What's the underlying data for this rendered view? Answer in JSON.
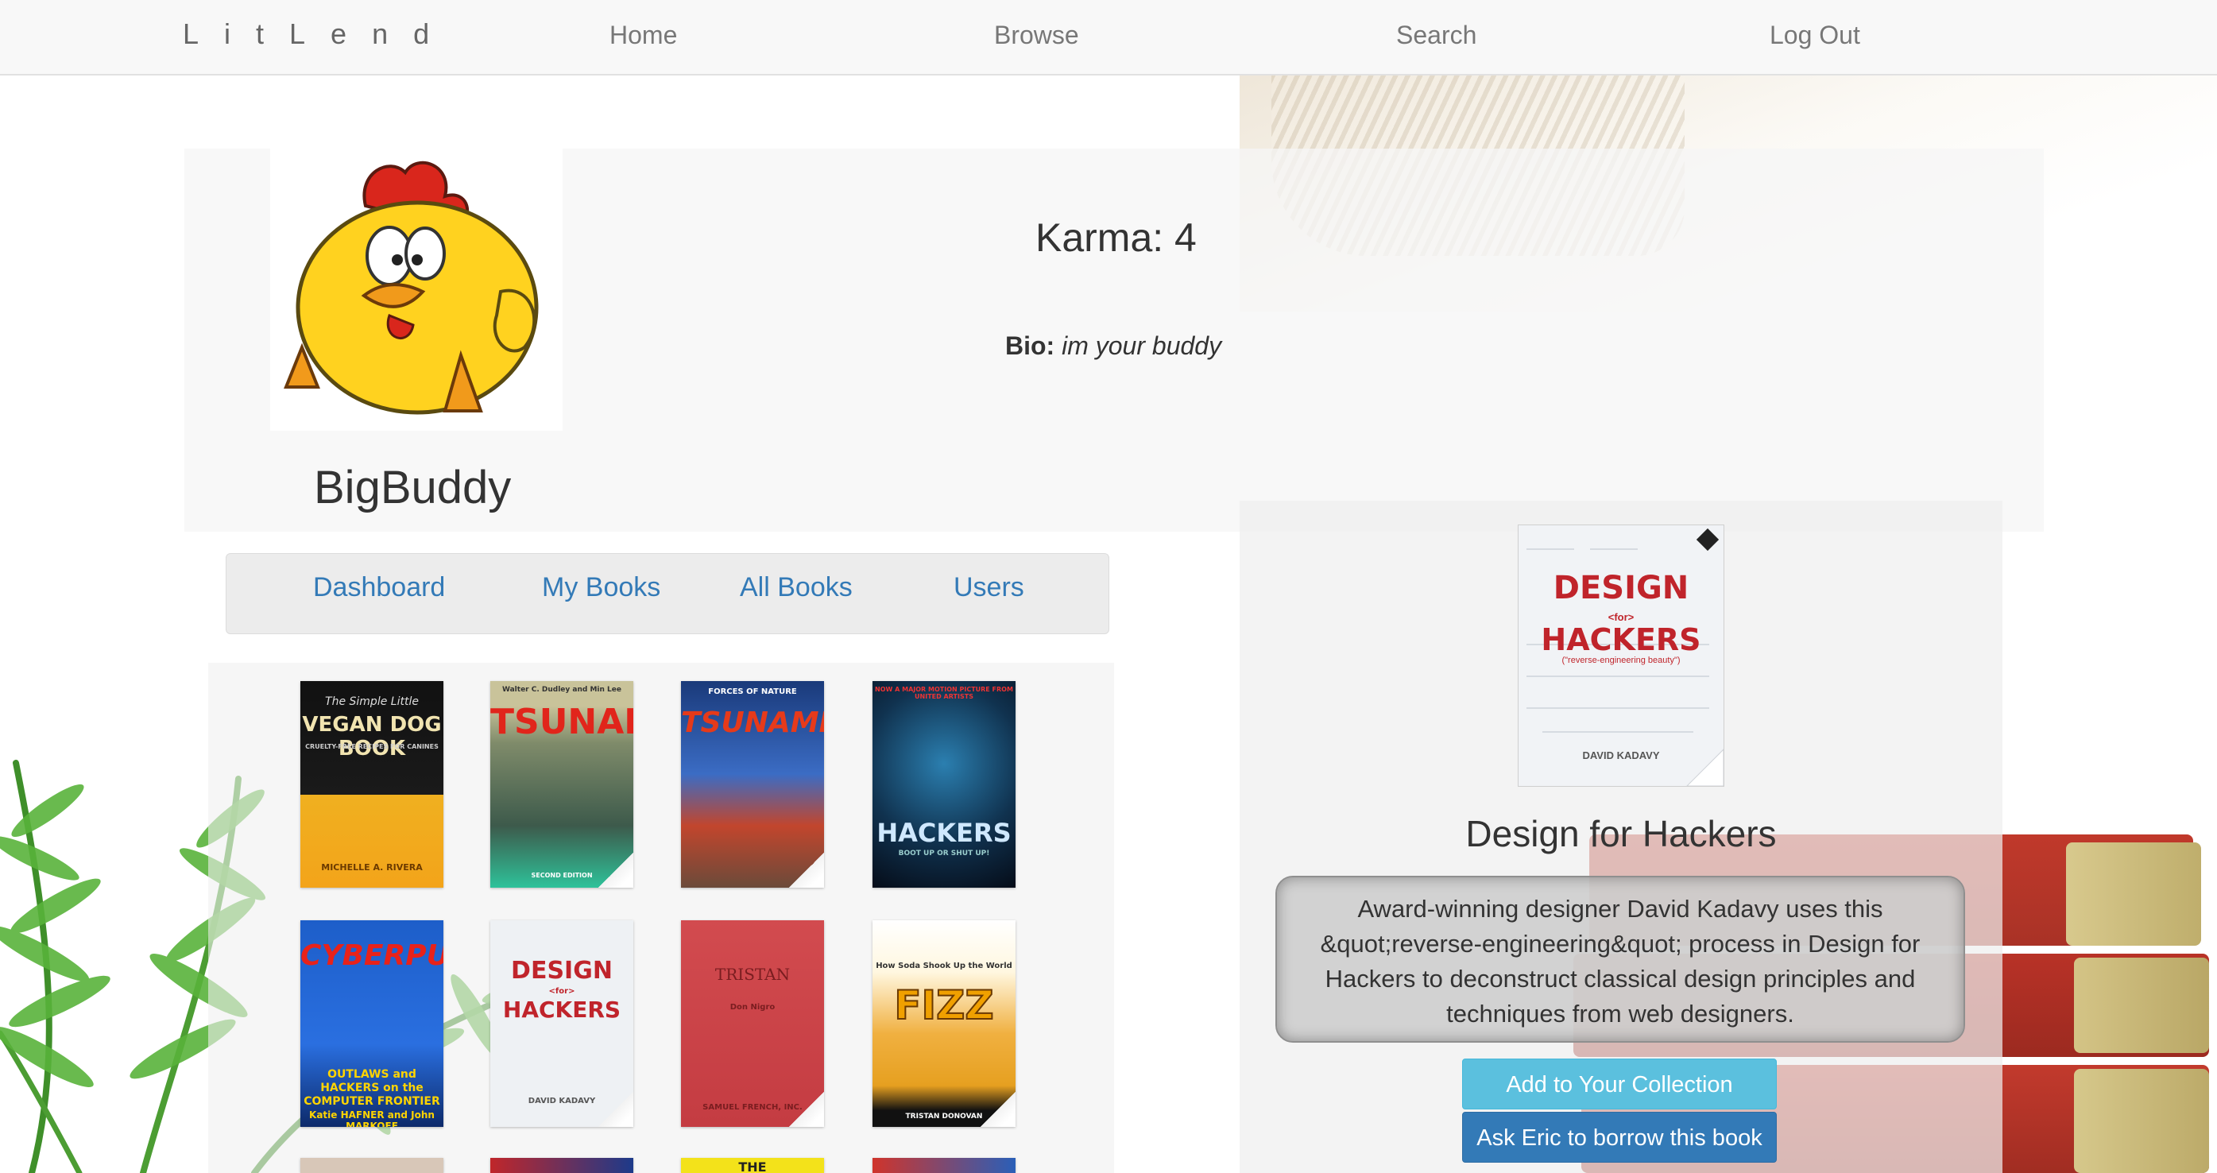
{
  "navbar": {
    "brand": "LitLend",
    "links": [
      "Home",
      "Browse",
      "Search",
      "Log Out"
    ]
  },
  "profile": {
    "username": "BigBuddy",
    "karma": "Karma: 4",
    "bio_label": "Bio:",
    "bio_text": "im your buddy"
  },
  "subnav": {
    "links": [
      "Dashboard",
      "My Books",
      "All Books",
      "Users"
    ]
  },
  "books": [
    {
      "cover_text": "VEGAN DOG BOOK",
      "cover_sub": "The Simple Little",
      "cover_small": "CRUELTY-FREE RECIPES FOR CANINES",
      "author": "MICHELLE A. RIVERA"
    },
    {
      "cover_text": "TSUNAMI!",
      "cover_small": "Walter C. Dudley and Min Lee",
      "author": "SECOND EDITION"
    },
    {
      "cover_text": "TSUNAMIS",
      "cover_small": "FORCES OF NATURE"
    },
    {
      "cover_text": "HACKERS",
      "cover_small": "NOW A MAJOR MOTION PICTURE FROM UNITED ARTISTS",
      "author": "BOOT UP OR SHUT UP!"
    },
    {
      "cover_text": "CYBERPUNK",
      "cover_small": "OUTLAWS and HACKERS on the COMPUTER FRONTIER",
      "author": "Katie HAFNER and John MARKOFF"
    },
    {
      "cover_text": "DESIGN",
      "cover_sub": "<for>",
      "cover_text2": "HACKERS",
      "author": "DAVID KADAVY"
    },
    {
      "cover_text": "TRISTAN",
      "cover_small": "Don Nigro",
      "author": "SAMUEL FRENCH, INC."
    },
    {
      "cover_text": "FIZZ",
      "cover_small": "How Soda Shook Up the World",
      "author": "TRISTAN DONOVAN"
    },
    {
      "cover_text": ""
    },
    {
      "cover_text": ""
    },
    {
      "cover_text": "THE"
    },
    {
      "cover_text": ""
    }
  ],
  "detail": {
    "title": "Design for Hackers",
    "cover": {
      "line1": "DESIGN",
      "line2": "<for>",
      "line3": "HACKERS",
      "sub": "(\"reverse-engineering beauty\")",
      "author": "DAVID KADAVY"
    },
    "description": "Award-winning designer David Kadavy uses this &quot;reverse-engineering&quot; process in Design for Hackers to deconstruct classical design principles and techniques from web designers.",
    "add_button": "Add to Your Collection",
    "ask_button": "Ask Eric to borrow this book"
  },
  "colors": {
    "link": "#337ab7",
    "info_button": "#5bc0de",
    "primary_button": "#337ab7",
    "design_red": "#c0242b"
  }
}
